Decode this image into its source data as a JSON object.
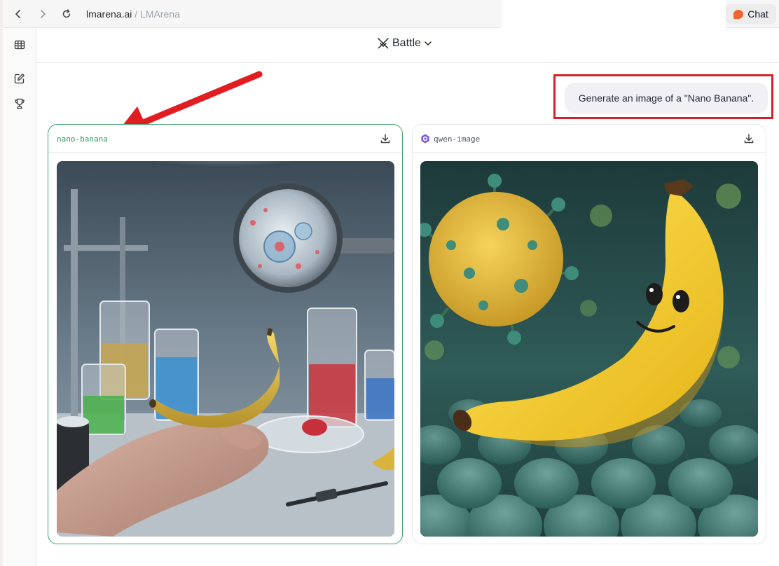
{
  "browser": {
    "url_domain": "lmarena.ai",
    "url_separator": "/",
    "page_title": "LMArena",
    "chat_button_label": "Chat"
  },
  "sidebar": {
    "icons": [
      "leaderboard-table-icon",
      "new-chat-icon",
      "trophy-icon"
    ]
  },
  "header": {
    "mode_label": "Battle",
    "mode_icon": "crossed-swords-icon"
  },
  "prompt": {
    "text": "Generate an image of a \"Nano Banana\"."
  },
  "responses": [
    {
      "model": "nano-banana",
      "image_alt": "Realistic tiny banana balanced on a fingertip in a laboratory with beakers and a magnifying glass showing cells"
    },
    {
      "model": "qwen-image",
      "image_alt": "Cartoon yellow banana with a smiling face floating in front of a virus-like sphere over green cells"
    }
  ],
  "colors": {
    "accent_green": "#2e9b5c",
    "annotation_red": "#d4202a",
    "chat_orange": "#f0642f"
  }
}
